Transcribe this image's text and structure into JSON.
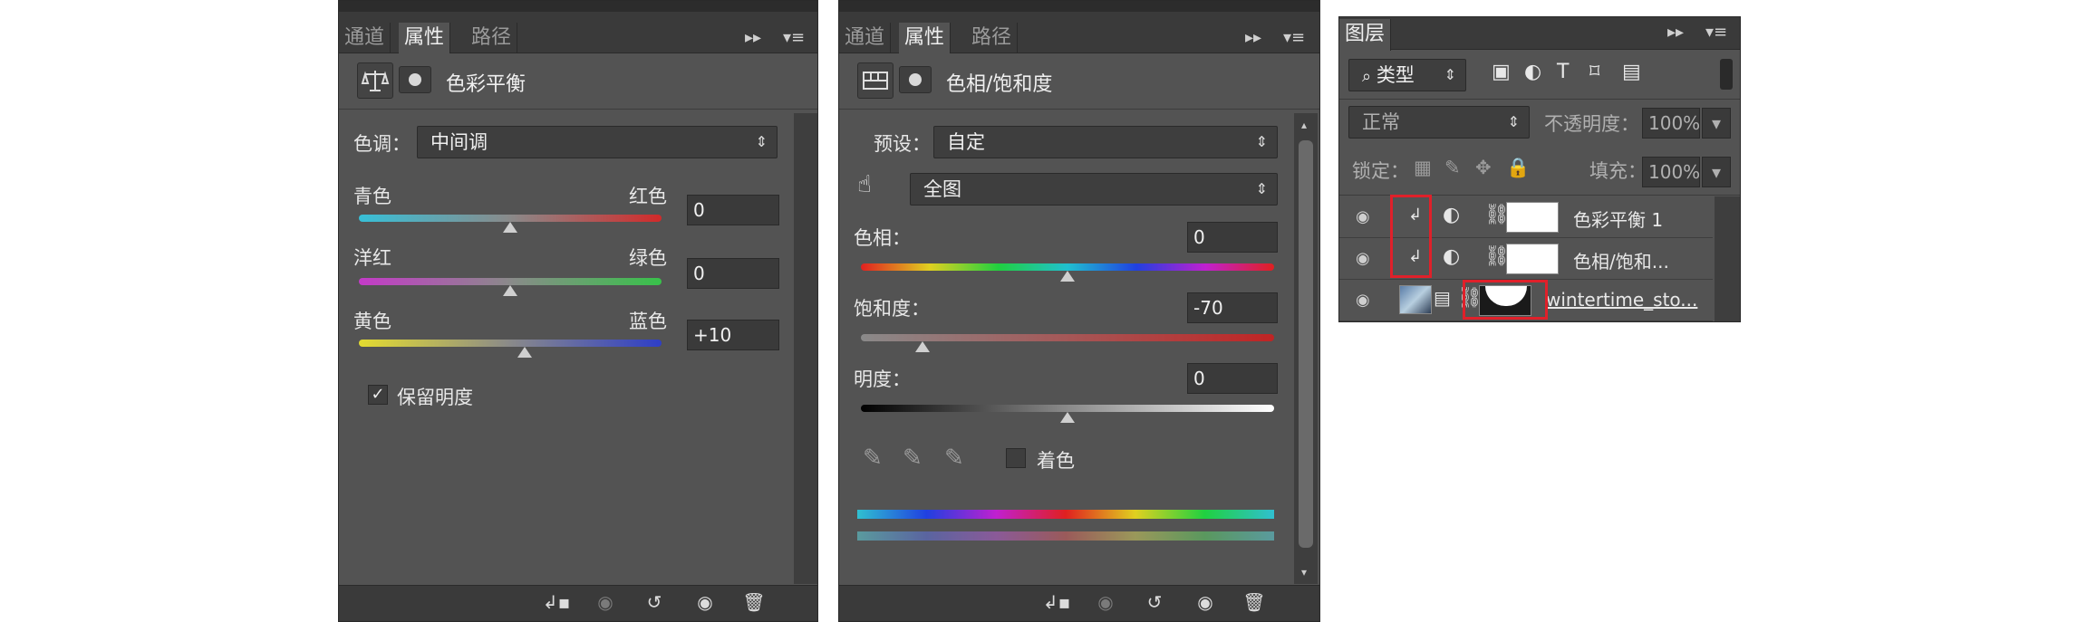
{
  "panel1": {
    "tabs": [
      "通道",
      "属性",
      "路径"
    ],
    "title": "色彩平衡",
    "tone_label": "色调：",
    "tone_value": "中间调",
    "sliders": [
      {
        "left": "青色",
        "right": "红色",
        "value": "0"
      },
      {
        "left": "洋红",
        "right": "绿色",
        "value": "0"
      },
      {
        "left": "黄色",
        "right": "蓝色",
        "value": "+10"
      }
    ],
    "preserve_label": "保留明度",
    "preserve_checked": "✓"
  },
  "panel2": {
    "tabs": [
      "通道",
      "属性",
      "路径"
    ],
    "title": "色相/饱和度",
    "preset_label": "预设：",
    "preset_value": "自定",
    "range_value": "全图",
    "hue_label": "色相：",
    "hue_value": "0",
    "sat_label": "饱和度：",
    "sat_value": "-70",
    "light_label": "明度：",
    "light_value": "0",
    "colorize_label": "着色"
  },
  "panel3": {
    "tab": "图层",
    "filter_label": "类型",
    "blend_mode": "正常",
    "opacity_label": "不透明度：",
    "opacity_value": "100%",
    "lock_label": "锁定：",
    "fill_label": "填充：",
    "fill_value": "100%",
    "layers": [
      {
        "name": "色彩平衡 1"
      },
      {
        "name": "色相/饱和..."
      },
      {
        "name": "wintertime_sto..."
      }
    ]
  },
  "colors": {
    "panel_bg": "#535353",
    "highlight": "#e0202a"
  },
  "icons": [
    "double-arrow-icon",
    "panel-menu-icon",
    "balance-scale-icon",
    "mask-icon",
    "eye-icon",
    "trash-icon",
    "reset-icon",
    "clip-icon",
    "eyedropper-icon",
    "link-icon",
    "lock-icon",
    "brush-icon",
    "move-icon"
  ]
}
